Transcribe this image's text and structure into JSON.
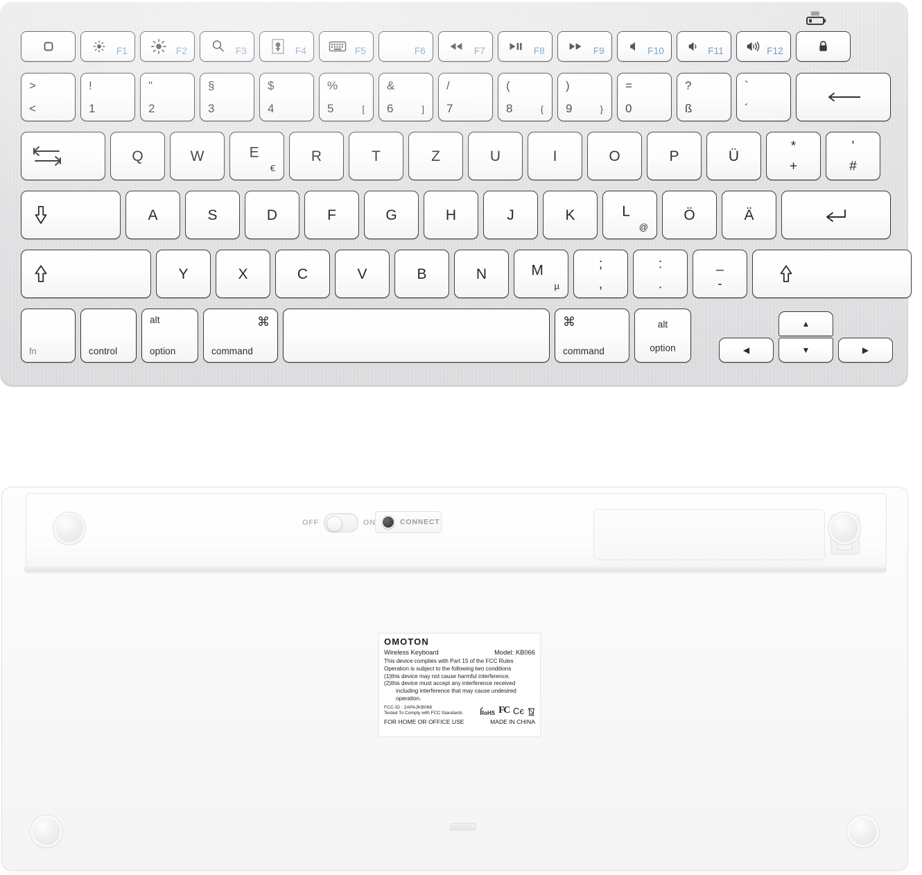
{
  "product": {
    "brand": "OMOTON",
    "name": "Wireless Keyboard",
    "model_label": "Model: KB066",
    "layout": "German QWERTZ"
  },
  "front": {
    "function_row": [
      {
        "icon": "display-square-icon",
        "fkey": ""
      },
      {
        "icon": "brightness-down-icon",
        "fkey": "F1"
      },
      {
        "icon": "brightness-up-icon",
        "fkey": "F2"
      },
      {
        "icon": "search-spotlight-icon",
        "fkey": "F3"
      },
      {
        "icon": "launchpad-icon",
        "fkey": "F4"
      },
      {
        "icon": "keyboard-backlight-icon",
        "fkey": "F5"
      },
      {
        "icon": "",
        "fkey": "F6"
      },
      {
        "icon": "rewind-icon",
        "fkey": "F7"
      },
      {
        "icon": "play-pause-icon",
        "fkey": "F8"
      },
      {
        "icon": "fast-forward-icon",
        "fkey": "F9"
      },
      {
        "icon": "volume-mute-icon",
        "fkey": "F10"
      },
      {
        "icon": "volume-down-icon",
        "fkey": "F11"
      },
      {
        "icon": "volume-up-icon",
        "fkey": "F12"
      },
      {
        "icon": "lock-icon",
        "fkey": ""
      }
    ],
    "battery_indicator_icon": "battery-level-icon",
    "number_row": [
      {
        "top": ">",
        "bottom": "<"
      },
      {
        "top": "!",
        "bottom": "1"
      },
      {
        "top": "\"",
        "bottom": "2"
      },
      {
        "top": "§",
        "bottom": "3"
      },
      {
        "top": "$",
        "bottom": "4"
      },
      {
        "top": "%",
        "bottom": "5",
        "alt": "["
      },
      {
        "top": "&",
        "bottom": "6",
        "alt": "]"
      },
      {
        "top": "/",
        "bottom": "7"
      },
      {
        "top": "(",
        "bottom": "8",
        "alt": "{"
      },
      {
        "top": ")",
        "bottom": "9",
        "alt": "}"
      },
      {
        "top": "=",
        "bottom": "0"
      },
      {
        "top": "?",
        "bottom": "ß"
      },
      {
        "top": "`",
        "bottom": "´"
      }
    ],
    "backspace_icon": "backspace-arrow-icon",
    "tab_icon": "tab-arrows-icon",
    "top_letter_row": [
      {
        "main": "Q"
      },
      {
        "main": "W"
      },
      {
        "main": "E",
        "alt": "€"
      },
      {
        "main": "R"
      },
      {
        "main": "T"
      },
      {
        "main": "Z"
      },
      {
        "main": "U"
      },
      {
        "main": "I"
      },
      {
        "main": "O"
      },
      {
        "main": "P"
      },
      {
        "main": "Ü"
      }
    ],
    "plus_key": {
      "top": "*",
      "bottom": "+"
    },
    "hash_key": {
      "top": "'",
      "bottom": "#"
    },
    "capslock_icon": "capslock-arrow-icon",
    "home_row": [
      {
        "main": "A"
      },
      {
        "main": "S"
      },
      {
        "main": "D"
      },
      {
        "main": "F"
      },
      {
        "main": "G"
      },
      {
        "main": "H"
      },
      {
        "main": "J"
      },
      {
        "main": "K"
      },
      {
        "main": "L",
        "alt": "@"
      },
      {
        "main": "Ö"
      },
      {
        "main": "Ä"
      }
    ],
    "return_icon": "return-arrow-icon",
    "shift_left_icon": "shift-arrow-icon",
    "shift_right_icon": "shift-arrow-icon",
    "bottom_letter_row": [
      {
        "main": "Y"
      },
      {
        "main": "X"
      },
      {
        "main": "C"
      },
      {
        "main": "V"
      },
      {
        "main": "B"
      },
      {
        "main": "N"
      },
      {
        "main": "M",
        "alt": "µ"
      }
    ],
    "punct_keys": [
      {
        "top": ";",
        "bottom": ","
      },
      {
        "top": ":",
        "bottom": "."
      },
      {
        "top": "_",
        "bottom": "-"
      }
    ],
    "modifier_row": {
      "fn": "fn",
      "control": "control",
      "alt_top": "alt",
      "option_bottom": "option",
      "command_glyph": "⌘",
      "command_word": "command",
      "space": ""
    },
    "arrows": {
      "left": "◀",
      "up": "▲",
      "down": "▼",
      "right": "▶"
    }
  },
  "back": {
    "power_switch": {
      "off_label": "OFF",
      "on_label": "ON",
      "state": "off"
    },
    "connect_button": {
      "label": "CONNECT",
      "icon": "connect-button-icon"
    },
    "battery_door": "battery-compartment-door",
    "battery_latch": "battery-latch",
    "feet_count": 4,
    "label": {
      "brand": "OMOTON",
      "product": "Wireless Keyboard",
      "model": "Model: KB066",
      "compliance_lines": [
        "This device complies with Part 15 of the FCC Rules",
        "Operation is subject to the following two conditions",
        "(1)this device may not cause harmful interference.",
        "(2)this device must accept any interference received",
        "including interference that may cause undesired",
        "operation."
      ],
      "fcc_id": "FCC-ID : 2APAJKB066",
      "fcc_tested": "Tested To Comply with FCC Standards",
      "use_text": "FOR HOME OR OFFICE USE",
      "origin": "MADE IN CHINA",
      "marks": {
        "rohs": "RoHS",
        "fcc": "FC",
        "ce": "Cє",
        "weee": "weee-bin-icon"
      }
    }
  },
  "colors": {
    "body_silver": "#dfe0e3",
    "key_white": "#ffffff",
    "key_border": "#3a3a3a",
    "fkey_blue": "#5d8fbe",
    "back_white": "#f9f9fa",
    "label_text": "#1b1b1b"
  }
}
